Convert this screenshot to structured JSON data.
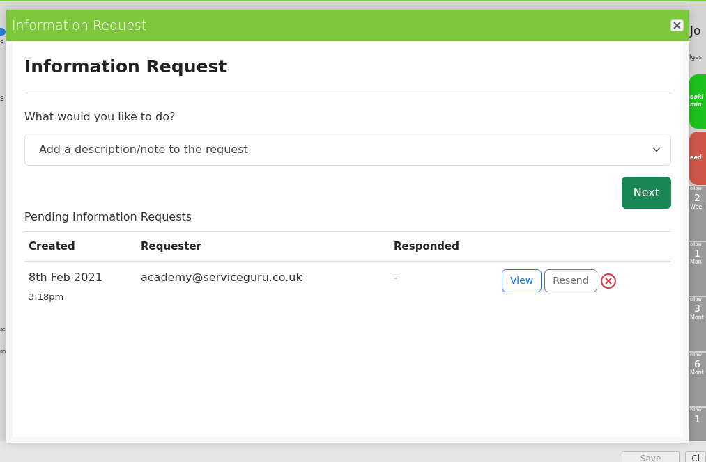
{
  "background": {
    "left_texts": [
      "S",
      "S",
      "ac",
      "on"
    ],
    "title": "Jo",
    "tab": "lges",
    "badges": [
      {
        "lines": [
          "ooki",
          "min"
        ],
        "color": "#1ec21e"
      },
      {
        "lines": [
          "eed"
        ],
        "color": "#d0564a"
      }
    ],
    "steps": [
      {
        "top": "ollow",
        "num": "2",
        "unit": "Weel"
      },
      {
        "top": "ollow",
        "num": "1",
        "unit": "Mon"
      },
      {
        "top": "ollow",
        "num": "3",
        "unit": "Mont"
      },
      {
        "top": "ollow",
        "num": "6",
        "unit": "Mont"
      },
      {
        "top": "ollow",
        "num": "1"
      }
    ],
    "buttons": [
      {
        "label": "Save",
        "disabled": true
      },
      {
        "label": "Cl",
        "disabled": false
      }
    ]
  },
  "modal": {
    "title": "Information Request",
    "heading": "Information Request",
    "question": "What would you like to do?",
    "select": {
      "value": "Add a description/note to the request"
    },
    "next_button": "Next",
    "section_title": "Pending Information Requests",
    "table": {
      "columns": [
        "Created",
        "Requester",
        "Responded"
      ],
      "rows": [
        {
          "created": "8th Feb 2021",
          "time": "3:18pm",
          "requester": "academy@serviceguru.co.uk",
          "responded": "-",
          "actions": [
            "View",
            "Resend"
          ]
        }
      ]
    }
  }
}
